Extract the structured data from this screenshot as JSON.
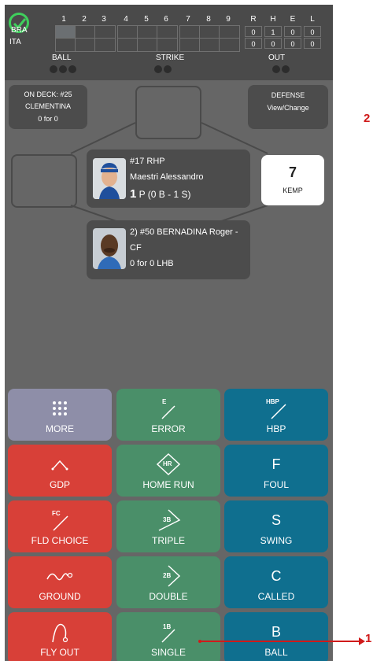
{
  "scoreboard": {
    "away_team": "BRA",
    "home_team": "ITA",
    "innings": [
      "1",
      "2",
      "3",
      "4",
      "5",
      "6",
      "7",
      "8",
      "9"
    ],
    "rhel_headers": [
      "R",
      "H",
      "E",
      "L"
    ],
    "away_rhel": [
      "0",
      "1",
      "0",
      "0"
    ],
    "home_rhel": [
      "0",
      "0",
      "0",
      "0"
    ],
    "ball_label": "BALL",
    "strike_label": "STRIKE",
    "out_label": "OUT",
    "balls": 0,
    "strikes": 1,
    "outs": 0
  },
  "on_deck": {
    "line1": "ON DECK: #25",
    "line2": "CLEMENTINA",
    "line3": "0 for 0"
  },
  "defense": {
    "line1": "DEFENSE",
    "line2": "View/Change"
  },
  "pitcher": {
    "line1": "#17 RHP",
    "line2": "Maestri Alessandro",
    "count_number": "1",
    "count_text": " P (0 B - 1 S)"
  },
  "catcher": {
    "number": "7",
    "name": "KEMP"
  },
  "batter": {
    "line1": "2) #50 BERNADINA Roger -",
    "line2": "CF",
    "line3": "0 for 0 LHB"
  },
  "buttons": {
    "more": "MORE",
    "error": "ERROR",
    "error_icon": "E",
    "hbp": "HBP",
    "hbp_icon": "HBP",
    "gdp": "GDP",
    "home_run": "HOME RUN",
    "home_run_icon": "HR",
    "foul": "FOUL",
    "foul_letter": "F",
    "fld_choice": "FLD CHOICE",
    "fld_choice_icon": "FC",
    "triple": "TRIPLE",
    "triple_icon": "3B",
    "swing": "SWING",
    "swing_letter": "S",
    "ground": "GROUND",
    "double": "DOUBLE",
    "double_icon": "2B",
    "called": "CALLED",
    "called_letter": "C",
    "fly_out": "FLY OUT",
    "single": "SINGLE",
    "single_icon": "1B",
    "ball": "BALL",
    "ball_letter": "B"
  },
  "annotations": {
    "callout_1": "1",
    "callout_2": "2"
  },
  "colors": {
    "out_red": "#d84038",
    "hit_green": "#4a8f69",
    "pitch_blue": "#0f6f8f",
    "more_grey": "#8e8ea8",
    "check_green": "#3fcf5c"
  },
  "icons": {
    "check": "check-circle-icon",
    "more": "grid-dots-icon"
  }
}
